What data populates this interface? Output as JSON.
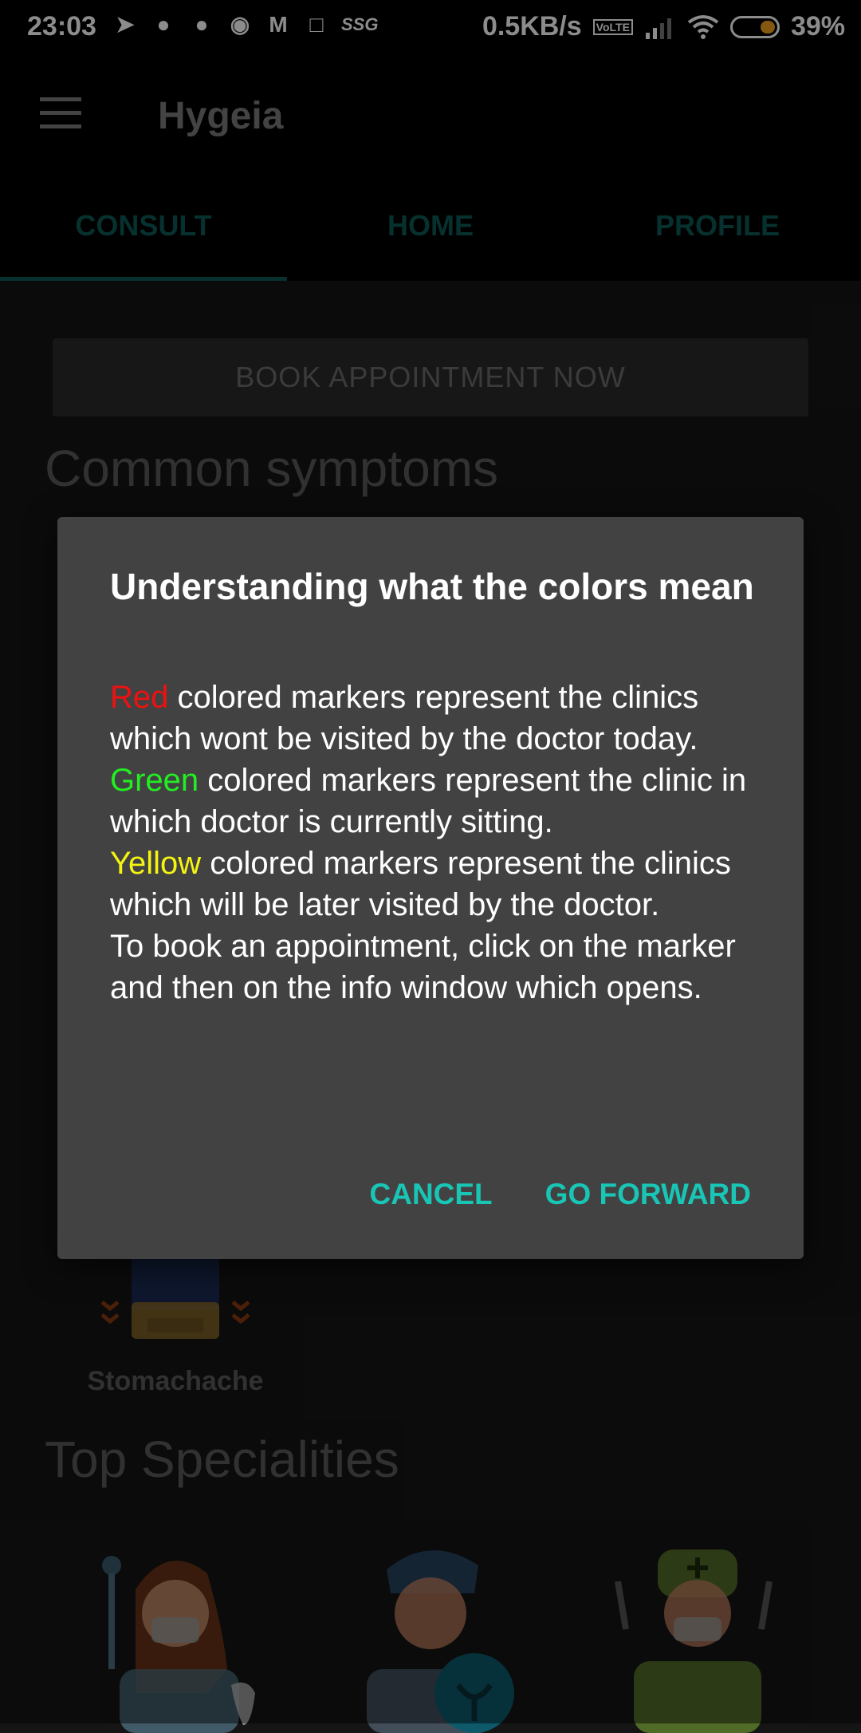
{
  "status_bar": {
    "time": "23:03",
    "net_speed": "0.5KB/s",
    "volte": "VoLTE",
    "battery": "39%",
    "left_icons": [
      "telegram-icon",
      "snapchat-icon",
      "snapchat-icon",
      "reddit-icon",
      "gmail-icon",
      "laptop-icon",
      "ssg-icon"
    ],
    "ssg_text": "SSG"
  },
  "appbar": {
    "title": "Hygeia"
  },
  "tabs": [
    {
      "label": "CONSULT",
      "selected": true
    },
    {
      "label": "HOME",
      "selected": false
    },
    {
      "label": "PROFILE",
      "selected": false
    }
  ],
  "main": {
    "book_button": "BOOK APPOINTMENT NOW",
    "common_symptoms_title": "Common symptoms",
    "symptom_label": "Stomachache",
    "top_specialities_title": "Top Specialities"
  },
  "dialog": {
    "title": "Understanding what the colors mean",
    "red_word": "Red",
    "red_text": " colored markers represent the clinics which wont be visited by the doctor today.",
    "green_word": "Green",
    "green_text": " colored markers represent the clinic in which doctor is currently sitting.",
    "yellow_word": "Yellow",
    "yellow_text": " colored markers represent the clinics which will be later visited by the doctor.",
    "booking_text": "To book an appointment, click on the marker and then on the info window which opens.",
    "cancel": "CANCEL",
    "forward": "GO FORWARD"
  },
  "colors": {
    "accent": "#19c5b5",
    "tab_dim": "#0b5a55",
    "dialog_bg": "#424242",
    "red": "#ee1111",
    "green": "#22ee22",
    "yellow": "#f4f411"
  }
}
